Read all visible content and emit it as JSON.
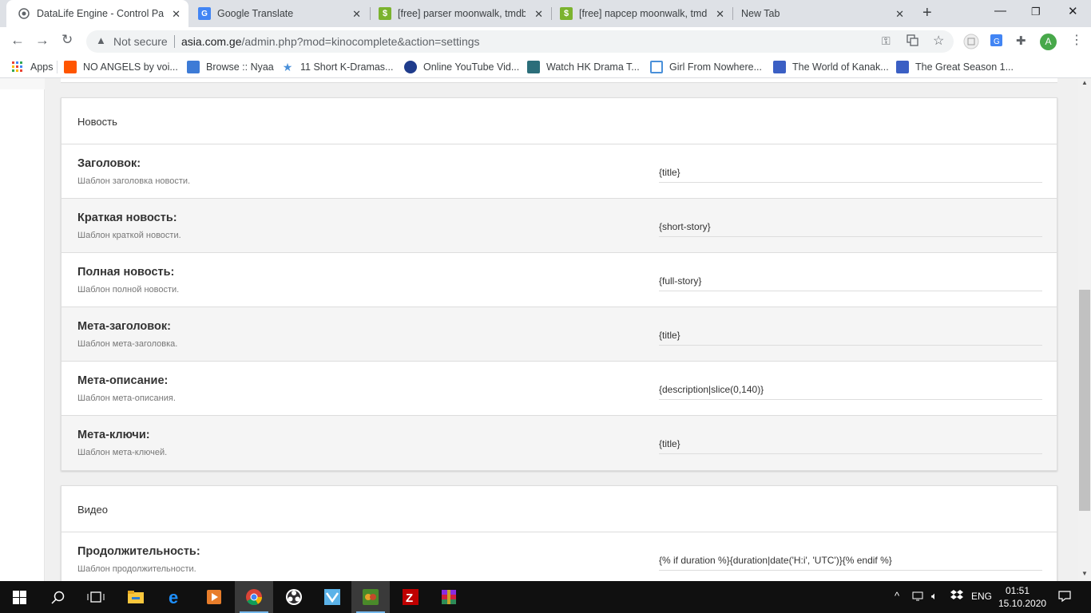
{
  "browser": {
    "tabs": [
      {
        "label": "DataLife Engine - Control Pane",
        "active": true,
        "icon": "globe-icon"
      },
      {
        "label": "Google Translate",
        "active": false,
        "icon": "google-translate-icon"
      },
      {
        "label": "[free] parser moonwalk, tmdb,",
        "active": false,
        "icon": "dollar-icon"
      },
      {
        "label": "[free] парсер moonwalk, tmdb",
        "active": false,
        "icon": "dollar-icon"
      },
      {
        "label": "New Tab",
        "active": false,
        "icon": ""
      }
    ],
    "not_secure": "Not secure",
    "url_host": "asia.com.ge",
    "url_path": "/admin.php?mod=kinocomplete&action=settings",
    "avatar_letter": "A"
  },
  "bookmarks": [
    {
      "label": "Apps",
      "icon": "apps-grid-icon",
      "color": "#4285f4"
    },
    {
      "label": "NO ANGELS by voi...",
      "icon": "soundcloud-icon",
      "color": "#ff5500"
    },
    {
      "label": "Browse :: Nyaa",
      "icon": "nyaa-icon",
      "color": "#3d7bd6"
    },
    {
      "label": "11 Short K-Dramas...",
      "icon": "star-icon",
      "color": "#4a90d9"
    },
    {
      "label": "Online YouTube Vid...",
      "icon": "video-icon",
      "color": "#1f3c8c"
    },
    {
      "label": "Watch HK Drama T...",
      "icon": "hk-drama-icon",
      "color": "#2b6e7a"
    },
    {
      "label": "Girl From Nowhere...",
      "icon": "girl-icon",
      "color": "#4a90d9"
    },
    {
      "label": "The World of Kanak...",
      "icon": "film-icon",
      "color": "#3b5fc4"
    },
    {
      "label": "The Great Season 1...",
      "icon": "film-icon",
      "color": "#3b5fc4"
    }
  ],
  "sections": [
    {
      "header": "Новость",
      "rows": [
        {
          "title": "Заголовок:",
          "desc": "Шаблон заголовка новости.",
          "value": "{title}"
        },
        {
          "title": "Краткая новость:",
          "desc": "Шаблон краткой новости.",
          "value": "{short-story}"
        },
        {
          "title": "Полная новость:",
          "desc": "Шаблон полной новости.",
          "value": "{full-story}"
        },
        {
          "title": "Мета-заголовок:",
          "desc": "Шаблон мета-заголовка.",
          "value": "{title}"
        },
        {
          "title": "Мета-описание:",
          "desc": "Шаблон мета-описания.",
          "value": "{description|slice(0,140)}"
        },
        {
          "title": "Мета-ключи:",
          "desc": "Шаблон мета-ключей.",
          "value": "{title}"
        }
      ]
    },
    {
      "header": "Видео",
      "rows": [
        {
          "title": "Продолжительность:",
          "desc": "Шаблон продолжительности.",
          "value": "{% if duration %}{duration|date('H:i', 'UTC')}{% endif %}"
        }
      ]
    }
  ],
  "taskbar": {
    "lang": "ENG",
    "time": "01:51",
    "date": "15.10.2020"
  }
}
